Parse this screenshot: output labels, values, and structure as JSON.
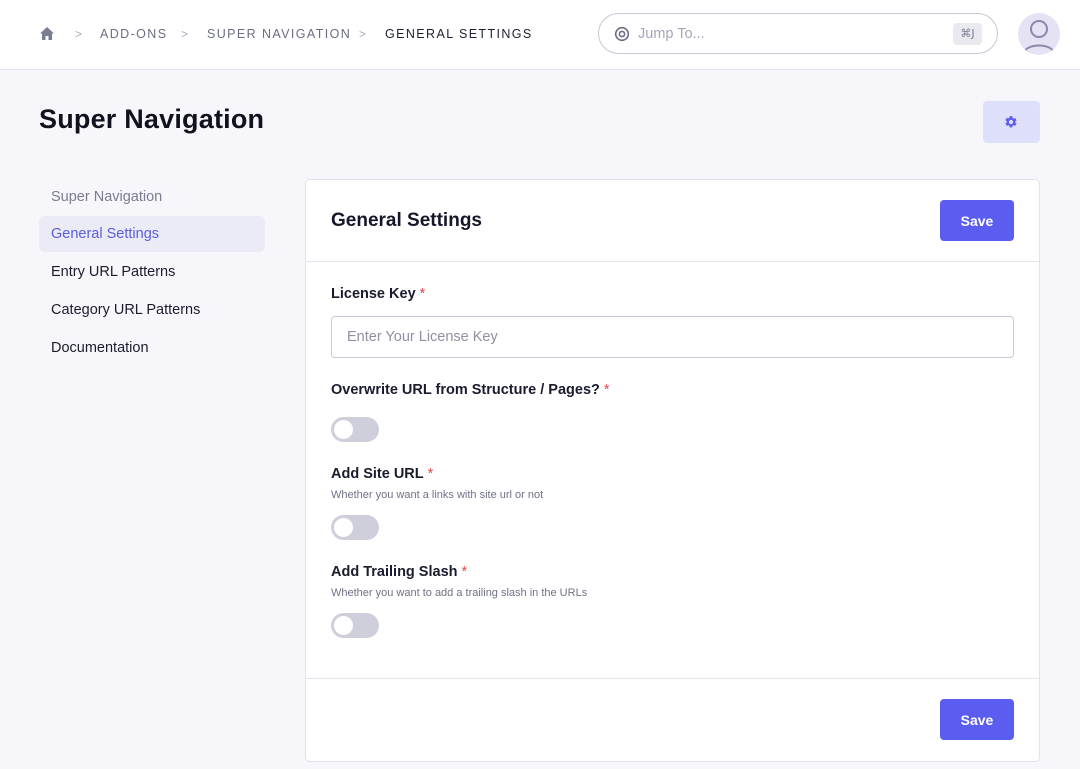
{
  "header": {
    "breadcrumbs": [
      {
        "label": "ADD-ONS"
      },
      {
        "label": "SUPER NAVIGATION"
      },
      {
        "label": "GENERAL SETTINGS"
      }
    ],
    "separator": ">",
    "jump": {
      "placeholder": "Jump To...",
      "shortcut": "⌘J"
    }
  },
  "page": {
    "title": "Super Navigation"
  },
  "sidebar": {
    "items": [
      {
        "label": "Super Navigation",
        "type": "heading"
      },
      {
        "label": "General Settings",
        "active": true
      },
      {
        "label": "Entry URL Patterns"
      },
      {
        "label": "Category URL Patterns"
      },
      {
        "label": "Documentation"
      }
    ]
  },
  "panel": {
    "title": "General Settings",
    "save_label": "Save",
    "fields": {
      "license": {
        "label": "License Key",
        "required_mark": "*",
        "placeholder": "Enter Your License Key",
        "value": ""
      },
      "overwrite_url": {
        "label": "Overwrite URL from Structure / Pages?",
        "required_mark": "*",
        "enabled": false
      },
      "add_site_url": {
        "label": "Add Site URL",
        "required_mark": "*",
        "description": "Whether you want a links with site url or not",
        "enabled": false
      },
      "trailing_slash": {
        "label": "Add Trailing Slash",
        "required_mark": "*",
        "description": "Whether you want to add a trailing slash in the URLs",
        "enabled": false
      }
    }
  },
  "colors": {
    "accent": "#5b5df0",
    "active_nav_text": "#5b5ce0",
    "active_nav_bg": "#ebebf6",
    "required": "#e5484d",
    "toggle_off": "#cfcfdb"
  },
  "icons": {
    "home": "home-icon",
    "jump": "target-icon",
    "settings": "gear-icon",
    "avatar": "user-avatar-icon"
  }
}
